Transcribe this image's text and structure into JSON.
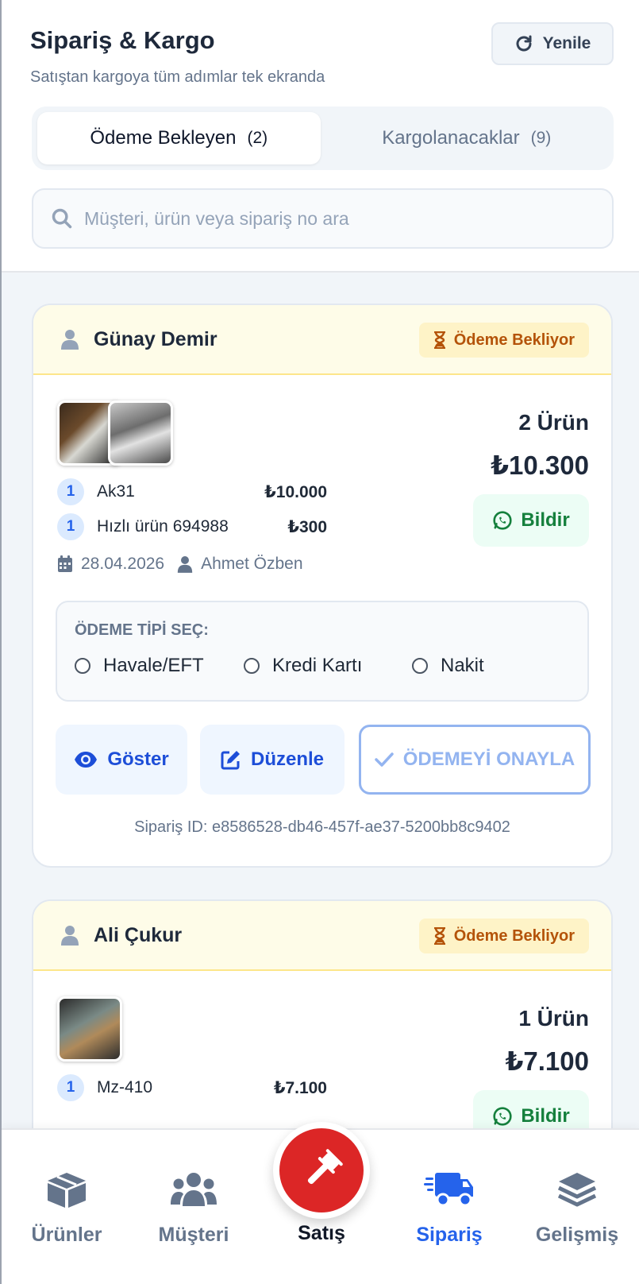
{
  "header": {
    "title": "Sipariş & Kargo",
    "subtitle": "Satıştan kargoya tüm adımlar tek ekranda",
    "refresh_label": "Yenile"
  },
  "tabs": [
    {
      "label": "Ödeme Bekleyen",
      "count": "(2)",
      "active": true
    },
    {
      "label": "Kargolanacaklar",
      "count": "(9)",
      "active": false
    }
  ],
  "search": {
    "placeholder": "Müşteri, ürün veya sipariş no ara",
    "value": ""
  },
  "orders": [
    {
      "customer": "Günay Demir",
      "status": "Ödeme Bekliyor",
      "items": [
        {
          "qty": "1",
          "name": "Ak31",
          "price": "₺10.000"
        },
        {
          "qty": "1",
          "name": "Hızlı ürün 694988",
          "price": "₺300"
        }
      ],
      "date": "28.04.2026",
      "seller": "Ahmet Özben",
      "count_label": "2 Ürün",
      "total": "₺10.300",
      "notify_label": "Bildir",
      "payment_title": "ÖDEME TİPİ SEÇ:",
      "payment_options": [
        "Havale/EFT",
        "Kredi Kartı",
        "Nakit"
      ],
      "show_label": "Göster",
      "edit_label": "Düzenle",
      "confirm_label": "ÖDEMEYİ ONAYLA",
      "order_id": "Sipariş ID: e8586528-db46-457f-ae37-5200bb8c9402"
    },
    {
      "customer": "Ali Çukur",
      "status": "Ödeme Bekliyor",
      "items": [
        {
          "qty": "1",
          "name": "Mz-410",
          "price": "₺7.100"
        }
      ],
      "count_label": "1 Ürün",
      "total": "₺7.100",
      "notify_label": "Bildir"
    }
  ],
  "nav": {
    "items": [
      "Ürünler",
      "Müşteri",
      "Satış",
      "Sipariş",
      "Gelişmiş"
    ],
    "active": "Sipariş"
  },
  "colors": {
    "accent": "#2563eb",
    "sale_button": "#dc2626",
    "pending_badge": "#b45309",
    "notify": "#15803d"
  }
}
